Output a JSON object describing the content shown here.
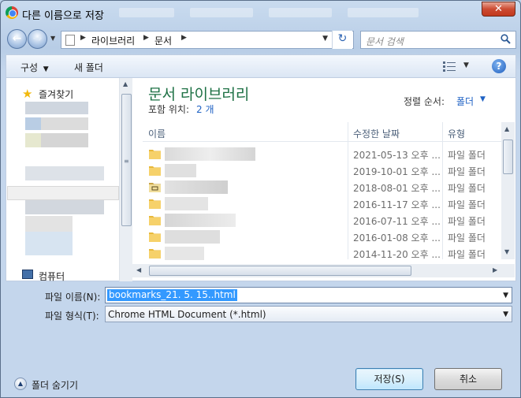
{
  "window": {
    "title": "다른 이름으로 저장",
    "close_label": "✕"
  },
  "nav": {
    "breadcrumb": [
      "라이브러리",
      "문서"
    ],
    "search_placeholder": "문서 검색"
  },
  "toolbar": {
    "organize": "구성",
    "new_folder": "새 폴더",
    "help": "?"
  },
  "navpane": {
    "favorites": "즐겨찾기",
    "computer": "컴퓨터"
  },
  "library": {
    "title": "문서 라이브러리",
    "includes_label": "포함 위치:",
    "includes_link": "2 개",
    "sort_label": "정렬 순서:",
    "sort_value": "폴더"
  },
  "columns": {
    "name": "이름",
    "modified": "수정한 날짜",
    "type": "유형"
  },
  "rows": [
    {
      "date": "2021-05-13 오후 ...",
      "type": "파일 폴더"
    },
    {
      "date": "2019-10-01 오후 ...",
      "type": "파일 폴더"
    },
    {
      "date": "2018-08-01 오후 ...",
      "type": "파일 폴더"
    },
    {
      "date": "2016-11-17 오후 ...",
      "type": "파일 폴더"
    },
    {
      "date": "2016-07-11 오후 ...",
      "type": "파일 폴더"
    },
    {
      "date": "2016-01-08 오후 ...",
      "type": "파일 폴더"
    },
    {
      "date": "2014-11-20 오후 ...",
      "type": "파일 폴더"
    }
  ],
  "fields": {
    "filename_label": "파일 이름(N):",
    "filename_value": "bookmarks_21. 5. 15..html",
    "filetype_label": "파일 형식(T):",
    "filetype_value": "Chrome HTML Document (*.html)"
  },
  "footer": {
    "hide_folders": "폴더 숨기기",
    "save": "저장(S)",
    "cancel": "취소"
  },
  "colors": {
    "library_title": "#1e7145",
    "link": "#1f62c4",
    "selection": "#3399ff"
  }
}
